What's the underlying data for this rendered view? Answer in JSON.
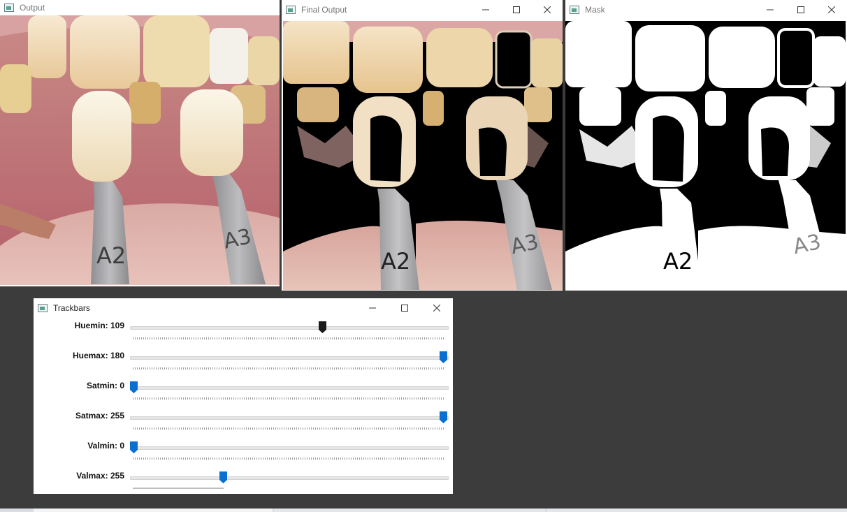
{
  "windows": {
    "output": {
      "title": "Output",
      "shade_guide_a": "A2",
      "shade_guide_b": "A3"
    },
    "final_output": {
      "title": "Final Output",
      "shade_guide_a": "A2",
      "shade_guide_b": "A3"
    },
    "mask": {
      "title": "Mask",
      "shade_guide_a": "A2",
      "shade_guide_b": "A3"
    },
    "trackbars": {
      "title": "Trackbars"
    }
  },
  "trackbars": [
    {
      "label": "Huemin: 109",
      "value": 109,
      "max": 179,
      "thumb_color": "#1a1a1a"
    },
    {
      "label": "Huemax: 180",
      "value": 180,
      "max": 180,
      "thumb_color": "#0a6fd1"
    },
    {
      "label": "Satmin: 0",
      "value": 0,
      "max": 255,
      "thumb_color": "#0a6fd1"
    },
    {
      "label": "Satmax: 255",
      "value": 255,
      "max": 255,
      "thumb_color": "#0a6fd1"
    },
    {
      "label": "Valmin: 0",
      "value": 0,
      "max": 255,
      "thumb_color": "#0a6fd1"
    },
    {
      "label": "Valmax: 255",
      "value": 255,
      "max": 255,
      "thumb_color": "#0a6fd1"
    }
  ],
  "colors": {
    "desktop": "#3c3c3c",
    "accent": "#0a6fd1"
  }
}
